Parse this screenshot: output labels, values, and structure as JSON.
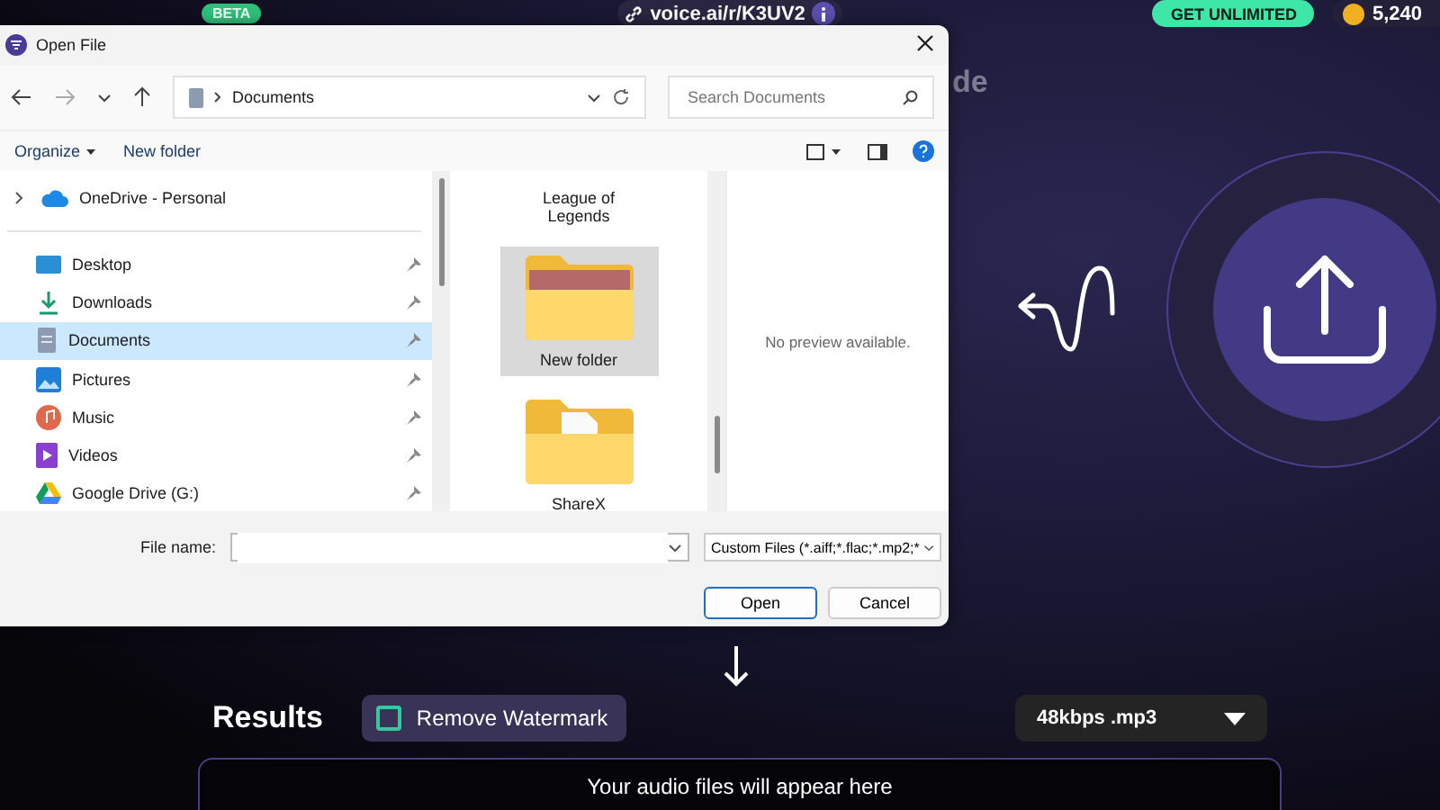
{
  "page": {
    "badge": "BETA",
    "referral_link": "voice.ai/r/K3UV2",
    "upgrade_button": "GET UNLIMITED",
    "credits": "5,240",
    "heading_fragment": "de"
  },
  "dialog": {
    "title": "Open File",
    "address": "Documents",
    "search": {
      "placeholder": "Search Documents"
    },
    "commands": [
      "Organize",
      "New folder"
    ],
    "nav_top": [
      {
        "label": "OneDrive - Personal",
        "kind": "cloud",
        "pinned": false,
        "expandable": true,
        "selected": false
      }
    ],
    "quick_access": [
      {
        "label": "Desktop",
        "kind": "desktop",
        "pinned": true,
        "expandable": false,
        "selected": false
      },
      {
        "label": "Downloads",
        "kind": "download",
        "pinned": true,
        "expandable": false,
        "selected": false
      },
      {
        "label": "Documents",
        "kind": "documents",
        "pinned": true,
        "expandable": false,
        "selected": true
      },
      {
        "label": "Pictures",
        "kind": "pictures",
        "pinned": true,
        "expandable": false,
        "selected": false
      },
      {
        "label": "Music",
        "kind": "music",
        "pinned": true,
        "expandable": false,
        "selected": false
      },
      {
        "label": "Videos",
        "kind": "videos",
        "pinned": true,
        "expandable": false,
        "selected": false
      },
      {
        "label": "Google Drive (G:)",
        "kind": "drive",
        "pinned": true,
        "expandable": false,
        "selected": false
      }
    ],
    "files": [
      {
        "name": "League of Legends",
        "kind": "scrolled",
        "selected": false
      },
      {
        "name": "New folder",
        "kind": "photo-folder",
        "selected": true
      },
      {
        "name": "ShareX",
        "kind": "document-folder",
        "selected": false
      }
    ],
    "preview": "No preview available.",
    "file_name_label": "File name:",
    "file_type": "Custom Files (*.aiff;*.flac;*.mp2;*",
    "buttons": [
      {
        "label": "Open",
        "default": true
      },
      {
        "label": "Cancel",
        "default": false
      }
    ]
  },
  "results": {
    "title": "Results",
    "watermark": {
      "label": "Remove Watermark",
      "checked": false
    },
    "format": "48kbps .mp3",
    "empty_message": "Your audio files will appear here"
  }
}
